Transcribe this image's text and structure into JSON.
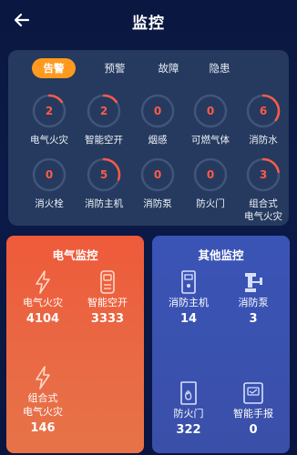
{
  "header": {
    "title": "监控"
  },
  "tabs": [
    {
      "label": "告警",
      "active": true
    },
    {
      "label": "预警",
      "active": false
    },
    {
      "label": "故障",
      "active": false
    },
    {
      "label": "隐患",
      "active": false
    }
  ],
  "alarms": [
    {
      "label": "电气火灾",
      "value": "2",
      "fraction": 0.15
    },
    {
      "label": "智能空开",
      "value": "2",
      "fraction": 0.15
    },
    {
      "label": "烟感",
      "value": "0",
      "fraction": 0
    },
    {
      "label": "可燃气体",
      "value": "0",
      "fraction": 0
    },
    {
      "label": "消防水",
      "value": "6",
      "fraction": 0.35
    },
    {
      "label": "消火栓",
      "value": "0",
      "fraction": 0
    },
    {
      "label": "消防主机",
      "value": "5",
      "fraction": 0.3
    },
    {
      "label": "消防泵",
      "value": "0",
      "fraction": 0
    },
    {
      "label": "防火门",
      "value": "0",
      "fraction": 0
    },
    {
      "label": "组合式\n电气火灾",
      "value": "3",
      "fraction": 0.22
    }
  ],
  "electrical": {
    "title": "电气监控",
    "items": [
      {
        "label": "电气火灾",
        "value": "4104",
        "icon": "lightning-icon"
      },
      {
        "label": "智能空开",
        "value": "3333",
        "icon": "smart-breaker-icon"
      },
      {
        "label": "组合式\n电气火灾",
        "value": "146",
        "icon": "lightning-icon"
      }
    ]
  },
  "other": {
    "title": "其他监控",
    "items": [
      {
        "label": "消防主机",
        "value": "14",
        "icon": "fire-host-icon"
      },
      {
        "label": "消防泵",
        "value": "3",
        "icon": "fire-pump-icon"
      },
      {
        "label": "防火门",
        "value": "322",
        "icon": "fire-door-icon"
      },
      {
        "label": "智能手报",
        "value": "0",
        "icon": "smart-alarm-icon"
      }
    ]
  },
  "colors": {
    "accent": "#ff9a1f",
    "alarm": "#ff5a4a",
    "panel": "#253a5e",
    "electrical_card": "#ee5a3a",
    "other_card": "#3a54b6"
  }
}
